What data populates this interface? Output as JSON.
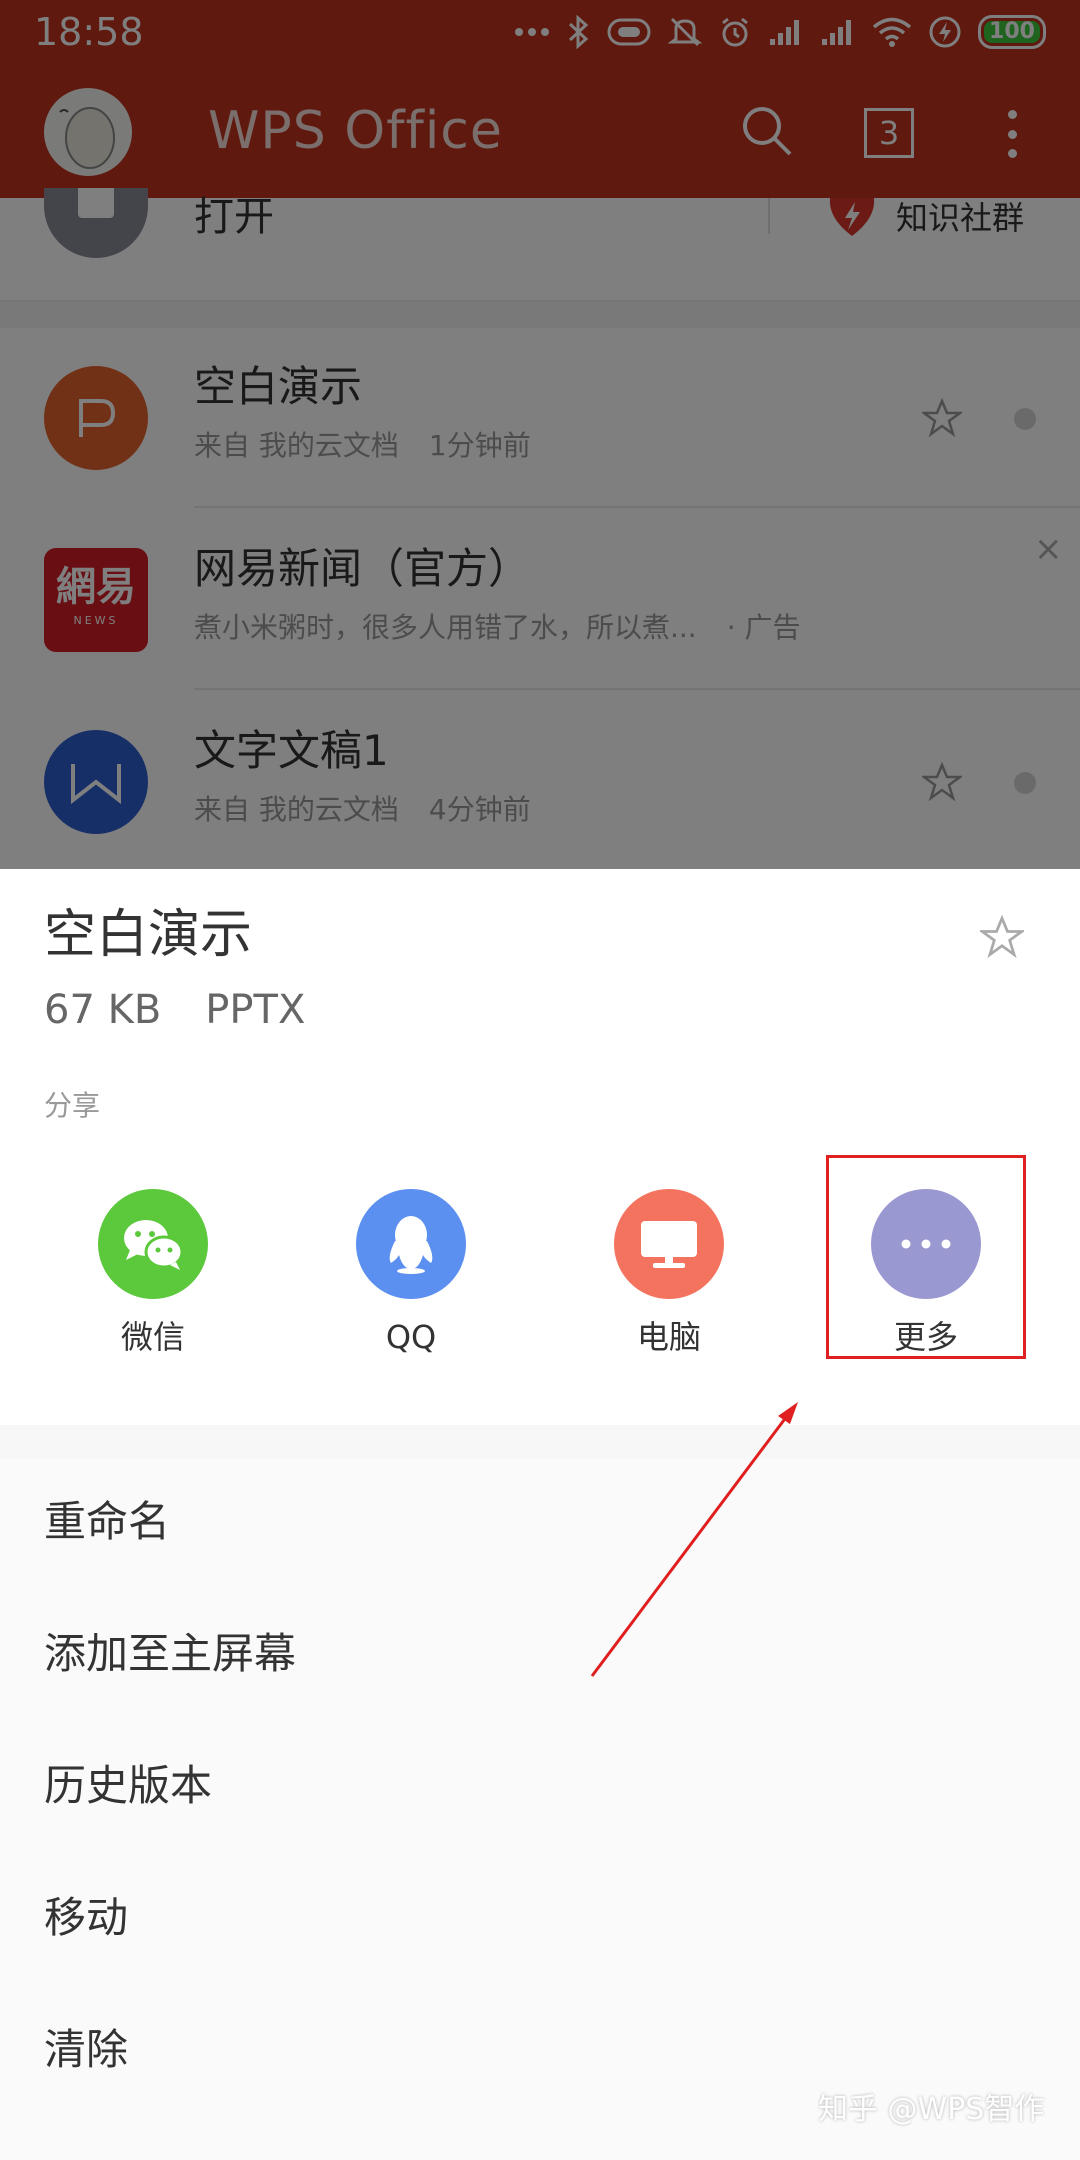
{
  "status_bar": {
    "time": "18:58",
    "battery_level": "100",
    "icons": [
      "more-icon",
      "bluetooth-icon",
      "vibrate-icon",
      "mute-icon",
      "alarm-icon",
      "signal-icon",
      "signal-icon",
      "wifi-icon",
      "charging-icon",
      "battery-icon"
    ]
  },
  "app_bar": {
    "title": "WPS Office",
    "tab_count": "3"
  },
  "quick_row": {
    "open_label": "打开",
    "community_label": "知识社群"
  },
  "doc_list": [
    {
      "title": "空白演示",
      "source": "来自 我的云文档",
      "time": "1分钟前",
      "icon_letter": "P",
      "icon_color": "#e2622c"
    },
    {
      "title": "网易新闻（官方）",
      "snippet": "煮小米粥时，很多人用错了水，所以煮...",
      "ad_label": "· 广告",
      "logo_text": "網易",
      "logo_sub": "NEWS"
    },
    {
      "title": "文字文稿1",
      "source": "来自 我的云文档",
      "time": "4分钟前",
      "icon_letter": "W",
      "icon_color": "#2f5fce"
    }
  ],
  "sheet": {
    "title": "空白演示",
    "size": "67 KB",
    "format": "PPTX",
    "share_label": "分享",
    "share_options": [
      {
        "label": "微信",
        "icon": "wechat-icon",
        "color": "#5cc83c"
      },
      {
        "label": "QQ",
        "icon": "qq-icon",
        "color": "#5b8ff0"
      },
      {
        "label": "电脑",
        "icon": "computer-icon",
        "color": "#f4735f"
      },
      {
        "label": "更多",
        "icon": "more-icon",
        "color": "#9a98d0"
      }
    ],
    "menu_items": [
      "重命名",
      "添加至主屏幕",
      "历史版本",
      "移动",
      "清除"
    ]
  },
  "colors": {
    "app_bar": "#c0331f",
    "highlight_box": "#e02020"
  },
  "watermark": "知乎 @WPS智作"
}
